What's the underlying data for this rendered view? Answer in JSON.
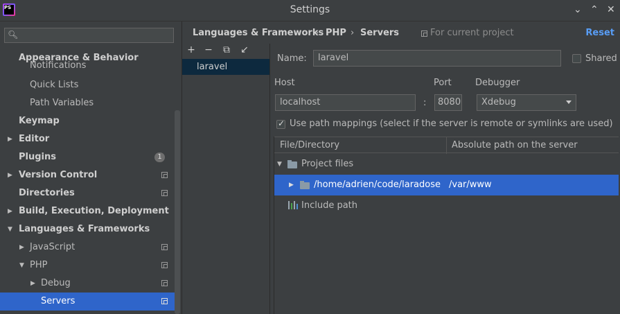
{
  "window": {
    "title": "Settings",
    "logo_text": "PS",
    "minimize": "⌄",
    "maximize": "⌃",
    "close": "✕"
  },
  "sidebar": {
    "search_placeholder": "",
    "items": [
      {
        "label": "Appearance & Behavior",
        "bold": true
      },
      {
        "label": "Notifications"
      },
      {
        "label": "Quick Lists"
      },
      {
        "label": "Path Variables"
      },
      {
        "label": "Keymap",
        "bold": true
      },
      {
        "label": "Editor",
        "bold": true
      },
      {
        "label": "Plugins",
        "bold": true,
        "badge": "1"
      },
      {
        "label": "Version Control",
        "bold": true
      },
      {
        "label": "Directories",
        "bold": true
      },
      {
        "label": "Build, Execution, Deployment",
        "bold": true
      },
      {
        "label": "Languages & Frameworks",
        "bold": true
      },
      {
        "label": "JavaScript"
      },
      {
        "label": "PHP"
      },
      {
        "label": "Debug"
      },
      {
        "label": "Servers",
        "selected": true
      }
    ]
  },
  "breadcrumb": {
    "parts": [
      "Languages & Frameworks",
      "PHP",
      "Servers"
    ],
    "separator": "›",
    "scope": "For current project",
    "reset": "Reset"
  },
  "servers": {
    "toolbar": [
      "+",
      "−",
      "⧉",
      "↙"
    ],
    "list": [
      "laravel"
    ]
  },
  "form": {
    "name_label": "Name:",
    "name_value": "laravel",
    "shared_label": "Shared",
    "host_label": "Host",
    "host_value": "localhost",
    "port_label": "Port",
    "port_sep": ":",
    "port_value": "8080",
    "debugger_label": "Debugger",
    "debugger_value": "Xdebug",
    "use_mappings_label": "Use path mappings (select if the server is remote or symlinks are used)"
  },
  "mappings": {
    "col_file": "File/Directory",
    "col_server": "Absolute path on the server",
    "project_files": "Project files",
    "row_local": "/home/adrien/code/laradose",
    "row_remote": "/var/www",
    "include_path": "Include path"
  },
  "colors": {
    "background": "#3c3f41",
    "selection": "#2f65ca",
    "link": "#589df6"
  }
}
